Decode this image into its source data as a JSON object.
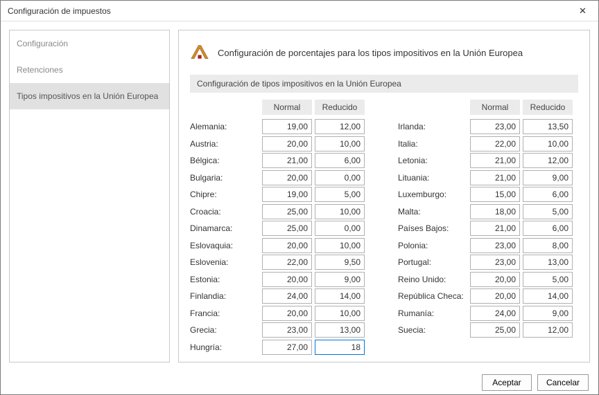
{
  "window": {
    "title": "Configuración de impuestos"
  },
  "sidebar": {
    "items": [
      {
        "label": "Configuración",
        "selected": false
      },
      {
        "label": "Retenciones",
        "selected": false
      },
      {
        "label": "Tipos impositivos en la Unión Europea",
        "selected": true
      }
    ]
  },
  "main": {
    "title": "Configuración de porcentajes para los tipos impositivos en la Unión Europea",
    "subtitle": "Configuración de tipos impositivos en la Unión Europea",
    "headers": {
      "normal": "Normal",
      "reducido": "Reducido"
    },
    "left": [
      {
        "country": "Alemania:",
        "normal": "19,00",
        "reducido": "12,00"
      },
      {
        "country": "Austria:",
        "normal": "20,00",
        "reducido": "10,00"
      },
      {
        "country": "Bélgica:",
        "normal": "21,00",
        "reducido": "6,00"
      },
      {
        "country": "Bulgaria:",
        "normal": "20,00",
        "reducido": "0,00"
      },
      {
        "country": "Chipre:",
        "normal": "19,00",
        "reducido": "5,00"
      },
      {
        "country": "Croacia:",
        "normal": "25,00",
        "reducido": "10,00"
      },
      {
        "country": "Dinamarca:",
        "normal": "25,00",
        "reducido": "0,00"
      },
      {
        "country": "Eslovaquia:",
        "normal": "20,00",
        "reducido": "10,00"
      },
      {
        "country": "Eslovenia:",
        "normal": "22,00",
        "reducido": "9,50"
      },
      {
        "country": "Estonia:",
        "normal": "20,00",
        "reducido": "9,00"
      },
      {
        "country": "Finlandia:",
        "normal": "24,00",
        "reducido": "14,00"
      },
      {
        "country": "Francia:",
        "normal": "20,00",
        "reducido": "10,00"
      },
      {
        "country": "Grecia:",
        "normal": "23,00",
        "reducido": "13,00"
      },
      {
        "country": "Hungría:",
        "normal": "27,00",
        "reducido": "18"
      }
    ],
    "right": [
      {
        "country": "Irlanda:",
        "normal": "23,00",
        "reducido": "13,50"
      },
      {
        "country": "Italia:",
        "normal": "22,00",
        "reducido": "10,00"
      },
      {
        "country": "Letonia:",
        "normal": "21,00",
        "reducido": "12,00"
      },
      {
        "country": "Lituania:",
        "normal": "21,00",
        "reducido": "9,00"
      },
      {
        "country": "Luxemburgo:",
        "normal": "15,00",
        "reducido": "6,00"
      },
      {
        "country": "Malta:",
        "normal": "18,00",
        "reducido": "5,00"
      },
      {
        "country": "Países Bajos:",
        "normal": "21,00",
        "reducido": "6,00"
      },
      {
        "country": "Polonia:",
        "normal": "23,00",
        "reducido": "8,00"
      },
      {
        "country": "Portugal:",
        "normal": "23,00",
        "reducido": "13,00"
      },
      {
        "country": "Reino Unido:",
        "normal": "20,00",
        "reducido": "5,00"
      },
      {
        "country": "República Checa:",
        "normal": "20,00",
        "reducido": "14,00"
      },
      {
        "country": "Rumanía:",
        "normal": "24,00",
        "reducido": "9,00"
      },
      {
        "country": "Suecia:",
        "normal": "25,00",
        "reducido": "12,00"
      }
    ],
    "focused": {
      "side": "left",
      "index": 13,
      "field": "reducido"
    }
  },
  "footer": {
    "accept": "Aceptar",
    "cancel": "Cancelar"
  }
}
